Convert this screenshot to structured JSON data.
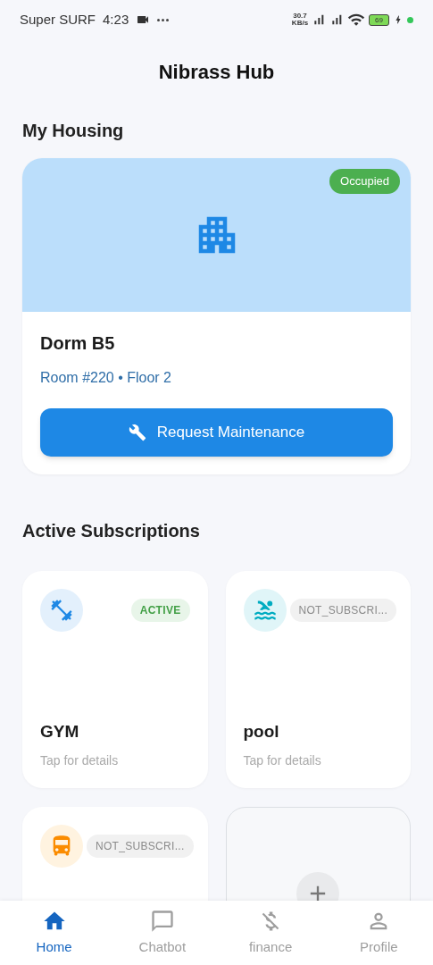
{
  "status_bar": {
    "carrier": "Super SURF",
    "time": "4:23",
    "speed": "30.7",
    "speed_unit": "KB/s",
    "battery": "69",
    "charging": true
  },
  "app_title": "Nibrass Hub",
  "housing": {
    "heading": "My Housing",
    "badge": "Occupied",
    "name": "Dorm B5",
    "details": "Room #220 • Floor 2",
    "button": "Request Maintenance"
  },
  "subscriptions": {
    "heading": "Active Subscriptions",
    "items": [
      {
        "kind": "service",
        "name": "GYM",
        "hint": "Tap for details",
        "status": "ACTIVE",
        "active": true,
        "color": "#1e88e5"
      },
      {
        "kind": "service",
        "name": "pool",
        "hint": "Tap for details",
        "status": "NOT_SUBSCRI...",
        "active": false,
        "color": "#00acc1"
      },
      {
        "kind": "service",
        "status": "NOT_SUBSCRI...",
        "active": false,
        "color": "#fb8c00"
      },
      {
        "kind": "add"
      }
    ]
  },
  "nav": [
    {
      "label": "Home",
      "selected": true
    },
    {
      "label": "Chatbot",
      "selected": false
    },
    {
      "label": "finance",
      "selected": false
    },
    {
      "label": "Profile",
      "selected": false
    }
  ]
}
